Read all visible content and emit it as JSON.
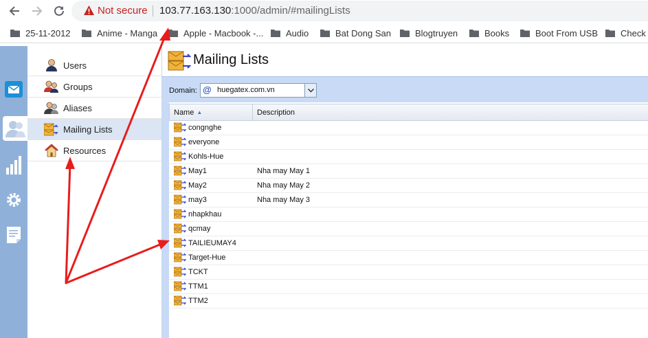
{
  "browser": {
    "security_label": "Not secure",
    "url_host": "103.77.163.130",
    "url_rest": ":1000/admin/#mailingLists",
    "bookmarks": [
      "25-11-2012",
      "Anime - Manga",
      "Apple - Macbook -...",
      "Audio",
      "Bat Dong San",
      "Blogtruyen",
      "Books",
      "Boot From USB",
      "Check I"
    ]
  },
  "rail": {
    "items": [
      "mail-icon",
      "users-icon",
      "stats-icon",
      "settings-icon",
      "notes-icon"
    ],
    "active": "users-icon"
  },
  "subnav": {
    "items": [
      {
        "label": "Users",
        "icon": "user-icon"
      },
      {
        "label": "Groups",
        "icon": "group-icon"
      },
      {
        "label": "Aliases",
        "icon": "alias-icon"
      },
      {
        "label": "Mailing Lists",
        "icon": "mailing-list-icon"
      },
      {
        "label": "Resources",
        "icon": "house-icon"
      }
    ],
    "selected": "Mailing Lists"
  },
  "main": {
    "title": "Mailing Lists",
    "domain_label": "Domain:",
    "domain_value": "huegatex.com.vn",
    "columns": {
      "name": "Name",
      "description": "Description"
    },
    "rows": [
      {
        "name": "congnghe",
        "description": ""
      },
      {
        "name": "everyone",
        "description": ""
      },
      {
        "name": "Kohls-Hue",
        "description": ""
      },
      {
        "name": "May1",
        "description": "Nha may May 1"
      },
      {
        "name": "May2",
        "description": "Nha may May 2"
      },
      {
        "name": "may3",
        "description": "Nha may May 3"
      },
      {
        "name": "nhapkhau",
        "description": ""
      },
      {
        "name": "qcmay",
        "description": ""
      },
      {
        "name": "TAILIEUMAY4",
        "description": ""
      },
      {
        "name": "Target-Hue",
        "description": ""
      },
      {
        "name": "TCKT",
        "description": ""
      },
      {
        "name": "TTM1",
        "description": ""
      },
      {
        "name": "TTM2",
        "description": ""
      }
    ]
  },
  "colors": {
    "rail": "#8fb1d9",
    "toolbar": "#c8daf5",
    "annotation_arrow": "#e81c1c",
    "not_secure": "#c5221f"
  }
}
